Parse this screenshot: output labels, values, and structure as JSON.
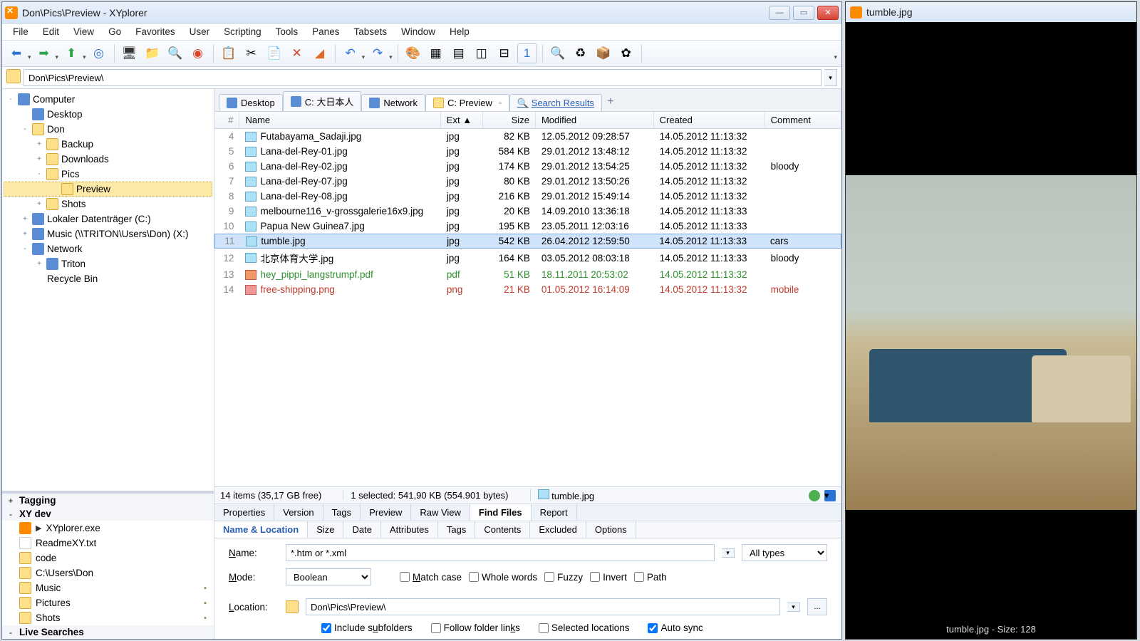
{
  "window": {
    "title": "Don\\Pics\\Preview - XYplorer"
  },
  "menu": [
    "File",
    "Edit",
    "View",
    "Go",
    "Favorites",
    "User",
    "Scripting",
    "Tools",
    "Panes",
    "Tabsets",
    "Window",
    "Help"
  ],
  "address": {
    "path": "Don\\Pics\\Preview\\"
  },
  "tree": [
    {
      "t": "Computer",
      "d": 0,
      "e": "-",
      "ic": "comp"
    },
    {
      "t": "Desktop",
      "d": 1,
      "e": "",
      "ic": "comp"
    },
    {
      "t": "Don",
      "d": 1,
      "e": "-",
      "ic": "fold",
      "home": true
    },
    {
      "t": "Backup",
      "d": 2,
      "e": "+",
      "ic": "fold"
    },
    {
      "t": "Downloads",
      "d": 2,
      "e": "+",
      "ic": "fold"
    },
    {
      "t": "Pics",
      "d": 2,
      "e": "-",
      "ic": "fold"
    },
    {
      "t": "Preview",
      "d": 3,
      "e": "",
      "ic": "fold",
      "sel": true
    },
    {
      "t": "Shots",
      "d": 2,
      "e": "+",
      "ic": "fold"
    },
    {
      "t": "Lokaler Datenträger (C:)",
      "d": 1,
      "e": "+",
      "ic": "drive"
    },
    {
      "t": "Music (\\\\TRITON\\Users\\Don) (X:)",
      "d": 1,
      "e": "+",
      "ic": "drive"
    },
    {
      "t": "Network",
      "d": 1,
      "e": "-",
      "ic": "net"
    },
    {
      "t": "Triton",
      "d": 2,
      "e": "+",
      "ic": "net"
    },
    {
      "t": "Recycle Bin",
      "d": 1,
      "e": "",
      "ic": "bin"
    }
  ],
  "catalog": [
    {
      "t": "Tagging",
      "hdr": true,
      "e": "+"
    },
    {
      "t": "XY dev",
      "hdr": true,
      "e": "-"
    },
    {
      "t": "XYplorer.exe",
      "ic": "app",
      "arrow": true
    },
    {
      "t": "ReadmeXY.txt",
      "ic": "txt"
    },
    {
      "t": "code",
      "ic": "fold"
    },
    {
      "t": "C:\\Users\\Don",
      "ic": "fold"
    },
    {
      "t": "Music",
      "ic": "fold",
      "x": true
    },
    {
      "t": "Pictures",
      "ic": "fold",
      "x": true
    },
    {
      "t": "Shots",
      "ic": "fold",
      "x": true
    },
    {
      "t": "Live Searches",
      "hdr": true,
      "e": "-"
    }
  ],
  "tabs": [
    {
      "label": "Desktop",
      "ic": "comp"
    },
    {
      "label": "C: 大日本人",
      "ic": "drive"
    },
    {
      "label": "Network",
      "ic": "net"
    },
    {
      "label": "C: Preview",
      "ic": "fold",
      "active": true
    },
    {
      "label": "Search Results",
      "ic": "search",
      "search": true
    }
  ],
  "columns": {
    "idx": "#",
    "name": "Name",
    "ext": "Ext ▲",
    "size": "Size",
    "mod": "Modified",
    "cre": "Created",
    "com": "Comment"
  },
  "files": [
    {
      "i": 4,
      "n": "Futabayama_Sadaji.jpg",
      "e": "jpg",
      "s": "82 KB",
      "m": "12.05.2012 09:28:57",
      "c": "14.05.2012 11:13:32",
      "cm": ""
    },
    {
      "i": 5,
      "n": "Lana-del-Rey-01.jpg",
      "e": "jpg",
      "s": "584 KB",
      "m": "29.01.2012 13:48:12",
      "c": "14.05.2012 11:13:32",
      "cm": ""
    },
    {
      "i": 6,
      "n": "Lana-del-Rey-02.jpg",
      "e": "jpg",
      "s": "174 KB",
      "m": "29.01.2012 13:54:25",
      "c": "14.05.2012 11:13:32",
      "cm": "bloody"
    },
    {
      "i": 7,
      "n": "Lana-del-Rey-07.jpg",
      "e": "jpg",
      "s": "80 KB",
      "m": "29.01.2012 13:50:26",
      "c": "14.05.2012 11:13:32",
      "cm": ""
    },
    {
      "i": 8,
      "n": "Lana-del-Rey-08.jpg",
      "e": "jpg",
      "s": "216 KB",
      "m": "29.01.2012 15:49:14",
      "c": "14.05.2012 11:13:32",
      "cm": ""
    },
    {
      "i": 9,
      "n": "melbourne116_v-grossgalerie16x9.jpg",
      "e": "jpg",
      "s": "20 KB",
      "m": "14.09.2010 13:36:18",
      "c": "14.05.2012 11:13:33",
      "cm": ""
    },
    {
      "i": 10,
      "n": "Papua New Guinea7.jpg",
      "e": "jpg",
      "s": "195 KB",
      "m": "23.05.2011 12:03:16",
      "c": "14.05.2012 11:13:33",
      "cm": ""
    },
    {
      "i": 11,
      "n": "tumble.jpg",
      "e": "jpg",
      "s": "542 KB",
      "m": "26.04.2012 12:59:50",
      "c": "14.05.2012 11:13:33",
      "cm": "cars",
      "sel": true
    },
    {
      "i": 12,
      "n": "北京体育大学.jpg",
      "e": "jpg",
      "s": "164 KB",
      "m": "03.05.2012 08:03:18",
      "c": "14.05.2012 11:13:33",
      "cm": "bloody"
    },
    {
      "i": 13,
      "n": "hey_pippi_langstrumpf.pdf",
      "e": "pdf",
      "s": "51 KB",
      "m": "18.11.2011 20:53:02",
      "c": "14.05.2012 11:13:32",
      "cm": "",
      "cls": "green"
    },
    {
      "i": 14,
      "n": "free-shipping.png",
      "e": "png",
      "s": "21 KB",
      "m": "01.05.2012 16:14:09",
      "c": "14.05.2012 11:13:32",
      "cm": "mobile",
      "cls": "red"
    }
  ],
  "status": {
    "count": "14 items (35,17 GB free)",
    "sel": "1 selected: 541,90 KB (554.901 bytes)",
    "file": "tumble.jpg"
  },
  "info_tabs": [
    "Properties",
    "Version",
    "Tags",
    "Preview",
    "Raw View",
    "Find Files",
    "Report"
  ],
  "info_active": "Find Files",
  "find_tabs": [
    "Name & Location",
    "Size",
    "Date",
    "Attributes",
    "Tags",
    "Contents",
    "Excluded",
    "Options"
  ],
  "find_active": "Name & Location",
  "find": {
    "name_label": "Name:",
    "name_value": "*.htm or *.xml",
    "type_value": "All types",
    "mode_label": "Mode:",
    "mode_value": "Boolean",
    "match_case": "Match case",
    "whole_words": "Whole words",
    "fuzzy": "Fuzzy",
    "invert": "Invert",
    "path": "Path",
    "location_label": "Location:",
    "location_value": "Don\\Pics\\Preview\\",
    "include_sub": "Include subfolders",
    "follow_links": "Follow folder links",
    "selected_loc": "Selected locations",
    "auto_sync": "Auto sync"
  },
  "preview": {
    "title": "tumble.jpg",
    "status": "tumble.jpg - Size: 128"
  }
}
